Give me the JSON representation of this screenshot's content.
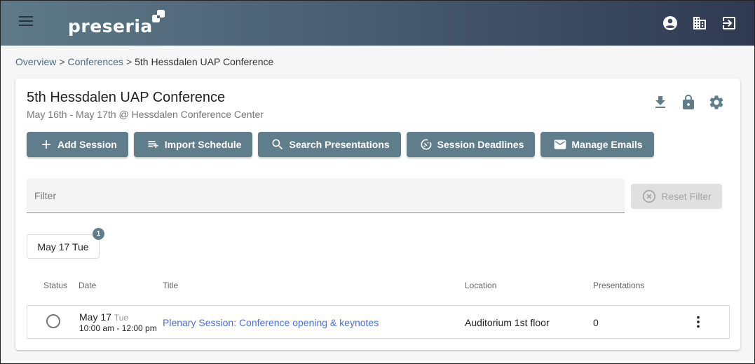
{
  "app": {
    "logo_text": "preseria",
    "top_icons": [
      "account-icon",
      "organization-icon",
      "logout-icon"
    ]
  },
  "breadcrumb": {
    "items": [
      "Overview",
      "Conferences"
    ],
    "separator": ">",
    "current": "5th Hessdalen UAP Conference"
  },
  "conference": {
    "title": "5th Hessdalen UAP Conference",
    "subtitle": "May 16th - May 17th @ Hessdalen Conference Center",
    "actions": [
      "download-icon",
      "lock-icon",
      "settings-icon"
    ]
  },
  "toolbar": {
    "add_session": "Add Session",
    "import_schedule": "Import Schedule",
    "search_presentations": "Search Presentations",
    "session_deadlines": "Session Deadlines",
    "manage_emails": "Manage Emails"
  },
  "filter": {
    "placeholder": "Filter",
    "value": "",
    "reset_label": "Reset Filter"
  },
  "days": [
    {
      "label": "May 17 Tue",
      "badge": "1"
    }
  ],
  "table": {
    "columns": {
      "status": "Status",
      "date": "Date",
      "title": "Title",
      "location": "Location",
      "presentations": "Presentations"
    },
    "rows": [
      {
        "date": "May 17",
        "weekday": "Tue",
        "time": "10:00 am - 12:00 pm",
        "title": "Plenary Session: Conference opening & keynotes",
        "location": "Auditorium 1st floor",
        "presentations": "0"
      }
    ]
  },
  "colors": {
    "primary": "#607d8b",
    "link": "#4a6fd6",
    "breadcrumb_link": "#4a6a80"
  }
}
